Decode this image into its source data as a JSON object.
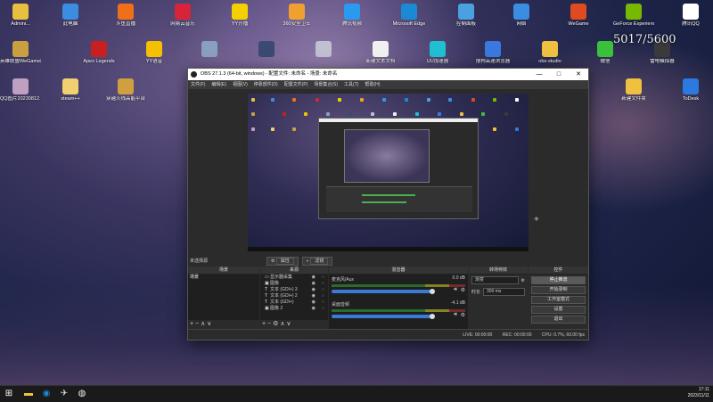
{
  "desktop": {
    "icons": [
      {
        "label": "Admini...",
        "color": "#e8c040"
      },
      {
        "label": "此电脑",
        "color": "#3a8de0"
      },
      {
        "label": "斗鱼直播",
        "color": "#f0701a"
      },
      {
        "label": "网易云音乐",
        "color": "#d8243a"
      },
      {
        "label": "YY开播",
        "color": "#f5d000"
      },
      {
        "label": "360安全卫士",
        "color": "#f0a030"
      },
      {
        "label": "腾讯视频",
        "color": "#2a9af0"
      },
      {
        "label": "Microsoft Edge",
        "color": "#1a8ad4"
      },
      {
        "label": "控制面板",
        "color": "#4aa0e0"
      },
      {
        "label": "网络",
        "color": "#3a8de0"
      },
      {
        "label": "WeGame",
        "color": "#e04a20"
      },
      {
        "label": "GeForce Experience",
        "color": "#76b900"
      },
      {
        "label": "腾讯QQ",
        "color": "#ffffff"
      },
      {
        "label": "英雄联盟WeGame版",
        "color": "#c8a040"
      },
      {
        "label": "Apex Legends",
        "color": "#c82020"
      },
      {
        "label": "YY语音",
        "color": "#f5c000"
      },
      {
        "label": "",
        "color": "#8aa0c0"
      },
      {
        "label": "",
        "color": "#3a4a70"
      },
      {
        "label": "",
        "color": "#c0c0d0"
      },
      {
        "label": "新建文本文档",
        "color": "#f0f0f0"
      },
      {
        "label": "UU加速器",
        "color": "#20c0d0"
      },
      {
        "label": "搜狗高速浏览器",
        "color": "#3a7ae0"
      },
      {
        "label": "obs-studio",
        "color": "#f0c040"
      },
      {
        "label": "微信",
        "color": "#3ac03a"
      },
      {
        "label": "雷电模拟器",
        "color": "#3a3a3a"
      },
      {
        "label": "QQ图片20230812...",
        "color": "#c0a0c0"
      },
      {
        "label": "steam++",
        "color": "#f0d070"
      },
      {
        "label": "穿越火线高能平台",
        "color": "#d0a040"
      },
      {
        "label": "新建文件夹",
        "color": "#f0c040"
      },
      {
        "label": "ToDesk",
        "color": "#2a7ae0"
      }
    ],
    "overlay_counter": "5017/5600"
  },
  "obs": {
    "title": "OBS 27.1.3 (64-bit, windows) - 配置文件: 未命名 - 场景: 未命名",
    "window_buttons": [
      "—",
      "□",
      "✕"
    ],
    "menu": [
      "文件(F)",
      "编辑(E)",
      "视图(V)",
      "停靠部件(D)",
      "配置文件(P)",
      "场景集合(S)",
      "工具(T)",
      "帮助(H)"
    ],
    "preview_label": "未选择源",
    "top_buttons": [
      "属性",
      "滤镜"
    ],
    "docks": {
      "scenes": {
        "title": "场景",
        "items": [
          "场景"
        ]
      },
      "sources": {
        "title": "来源",
        "items": [
          {
            "type": "screen",
            "label": "显示器采集"
          },
          {
            "type": "image",
            "label": "图像"
          },
          {
            "type": "text",
            "label": "文本 (GDI+) 3"
          },
          {
            "type": "text",
            "label": "文本 (GDI+) 2"
          },
          {
            "type": "text",
            "label": "文本 (GDI+)"
          },
          {
            "type": "image",
            "label": "图像 2"
          }
        ]
      },
      "mixer": {
        "title": "混音器",
        "tracks": [
          {
            "name": "麦克风/Aux",
            "db": "0.0 dB"
          },
          {
            "name": "桌面音频",
            "db": "-4.1 dB"
          }
        ]
      },
      "transitions": {
        "title": "转场特效",
        "type": "渐变",
        "duration_label": "时长",
        "duration": "300 ms"
      },
      "controls": {
        "title": "控件",
        "buttons": [
          "停止推流",
          "开始录制",
          "工作室模式",
          "设置",
          "退出"
        ]
      }
    },
    "status": {
      "live": "LIVE: 00:00:00",
      "rec": "REC: 00:00:00",
      "cpu": "CPU: 0.7%, 60.00 fps"
    }
  },
  "taskbar": {
    "time": "17:11",
    "date": "2023/11/11"
  }
}
